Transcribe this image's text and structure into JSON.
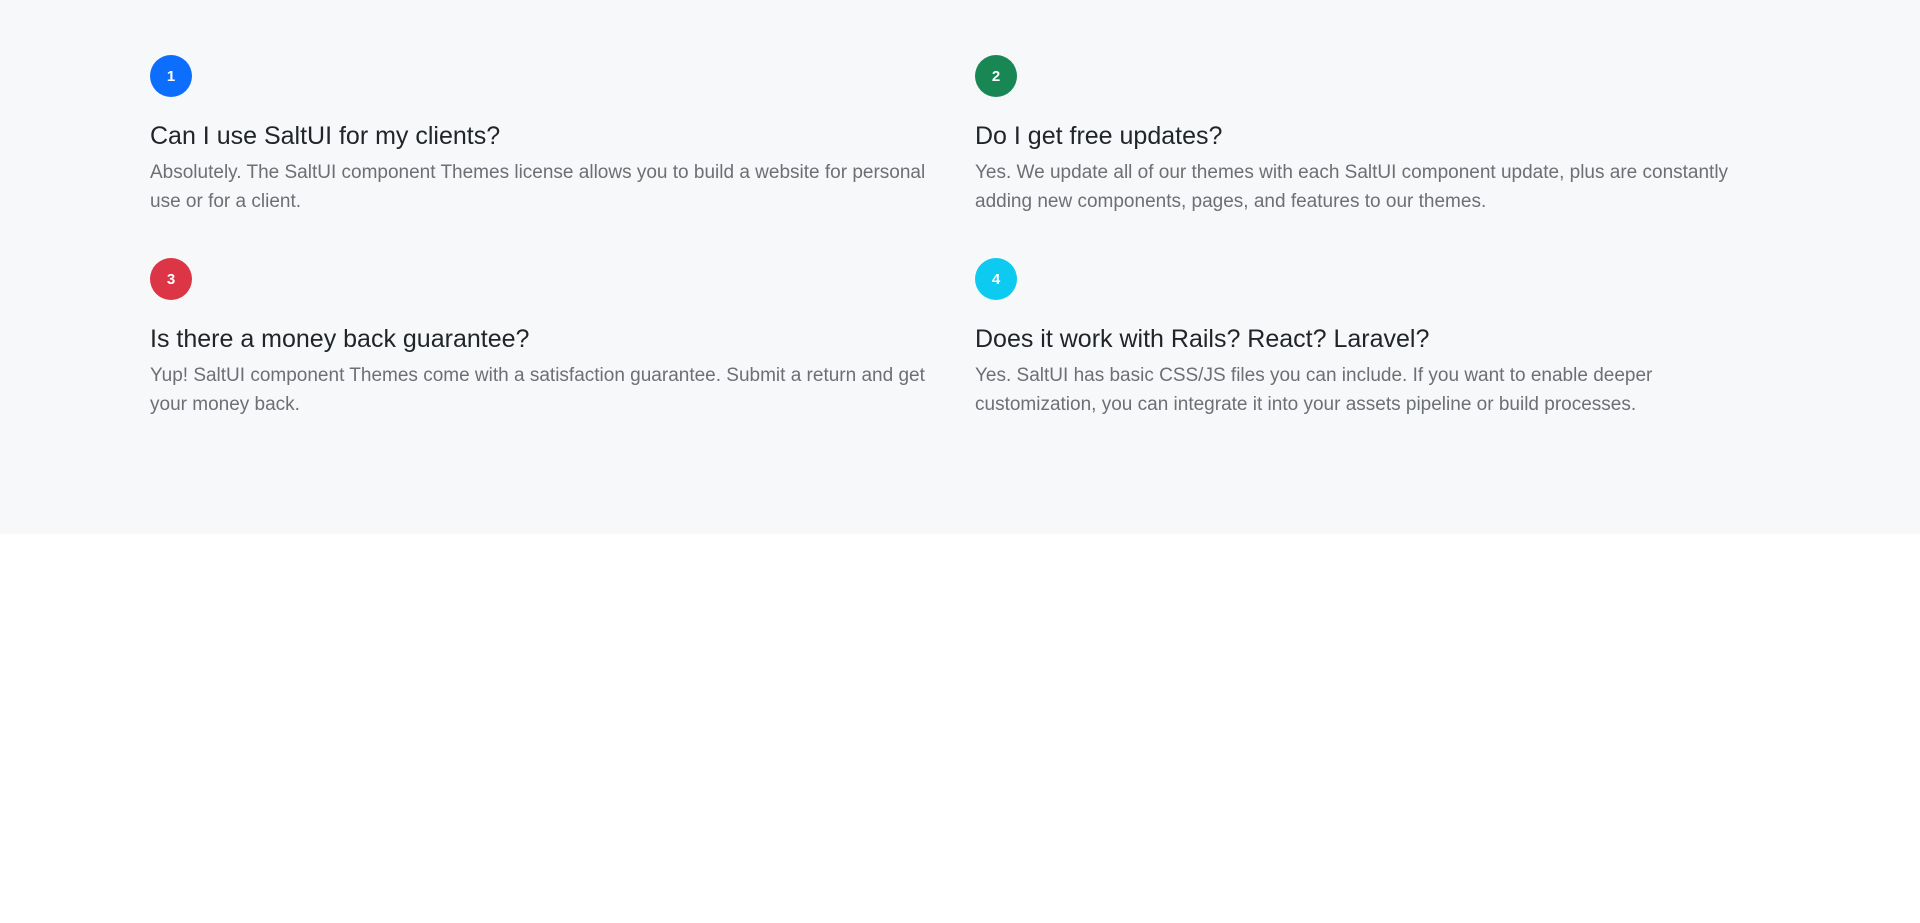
{
  "faq": {
    "items": [
      {
        "number": "1",
        "color": "#0d6efd",
        "question": "Can I use SaltUI for my clients?",
        "answer": "Absolutely. The SaltUI component Themes license allows you to build a website for personal use or for a client."
      },
      {
        "number": "2",
        "color": "#198754",
        "question": "Do I get free updates?",
        "answer": "Yes. We update all of our themes with each SaltUI component update, plus are constantly adding new components, pages, and features to our themes."
      },
      {
        "number": "3",
        "color": "#dc3545",
        "question": "Is there a money back guarantee?",
        "answer": "Yup! SaltUI component Themes come with a satisfaction guarantee. Submit a return and get your money back."
      },
      {
        "number": "4",
        "color": "#0dcaf0",
        "question": "Does it work with Rails? React? Laravel?",
        "answer": "Yes. SaltUI has basic CSS/JS files you can include. If you want to enable deeper customization, you can integrate it into your assets pipeline or build processes."
      }
    ]
  }
}
